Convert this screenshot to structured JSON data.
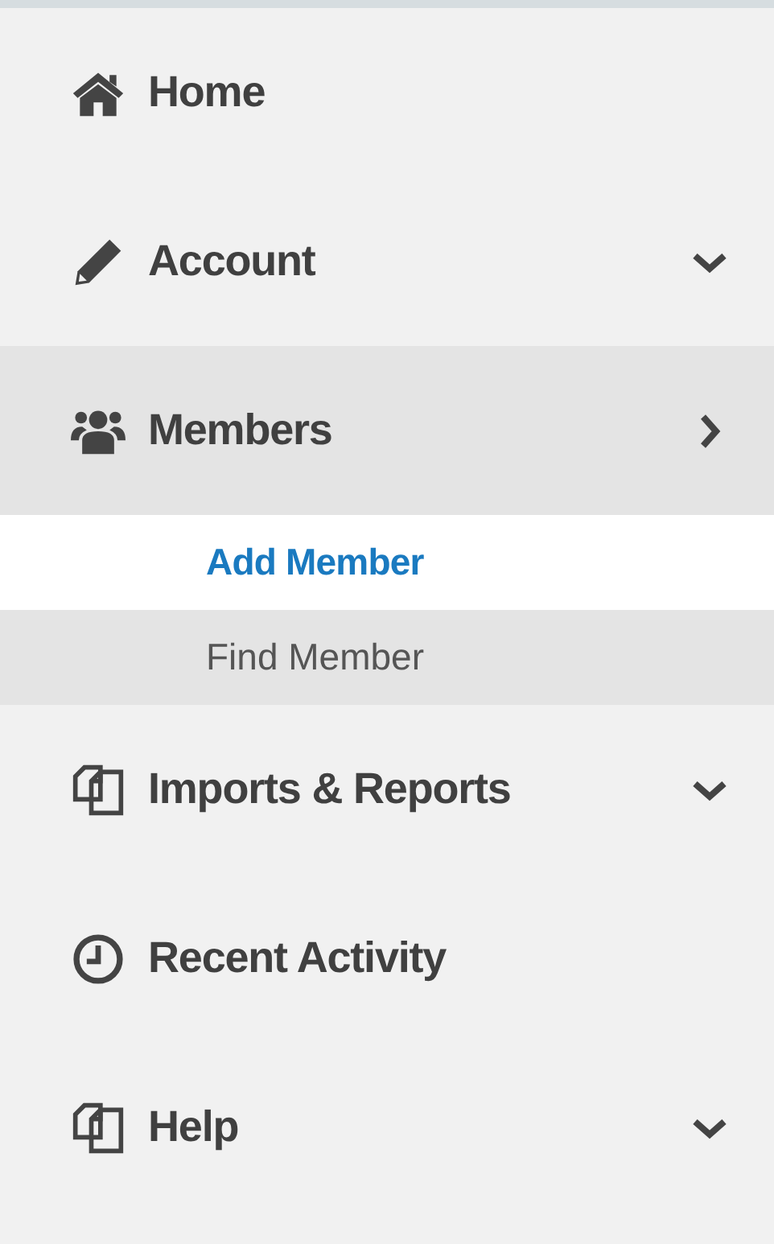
{
  "menu": [
    {
      "label": "Home",
      "selected": false
    },
    {
      "label": "Account",
      "expanded": false,
      "selected": false
    },
    {
      "label": "Members",
      "expanded": true,
      "selected": true,
      "children": [
        {
          "label": "Add Member",
          "selected": true
        },
        {
          "label": "Find Member",
          "selected": false
        }
      ]
    },
    {
      "label": "Imports & Reports",
      "expanded": false,
      "selected": false
    },
    {
      "label": "Recent Activity",
      "selected": false
    },
    {
      "label": "Help",
      "expanded": false,
      "selected": false
    }
  ]
}
